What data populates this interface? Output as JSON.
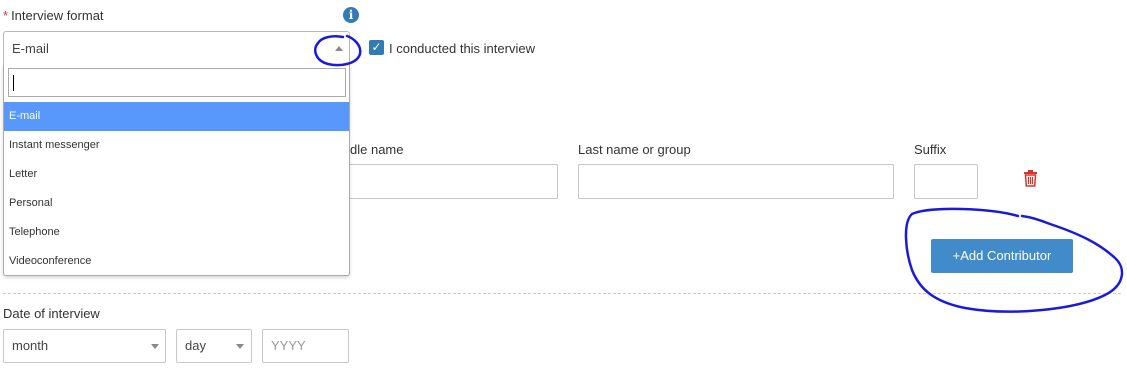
{
  "interview_format": {
    "label": "Interview format",
    "required_marker": "*",
    "selected": "E-mail",
    "search_value": "",
    "options": [
      "E-mail",
      "Instant messenger",
      "Letter",
      "Personal",
      "Telephone",
      "Videoconference"
    ],
    "info_icon": "info-icon"
  },
  "conducted": {
    "label": "I conducted this interview",
    "checked": true
  },
  "contributors": {
    "middle_name_label": "dle name",
    "last_name_label": "Last name or group",
    "suffix_label": "Suffix",
    "add_button_label": "+Add Contributor",
    "delete_icon": "trash-icon"
  },
  "date": {
    "label": "Date of interview",
    "month": "month",
    "day": "day",
    "year_placeholder": "YYYY"
  },
  "annotations": {
    "color": "#1a1adb"
  }
}
